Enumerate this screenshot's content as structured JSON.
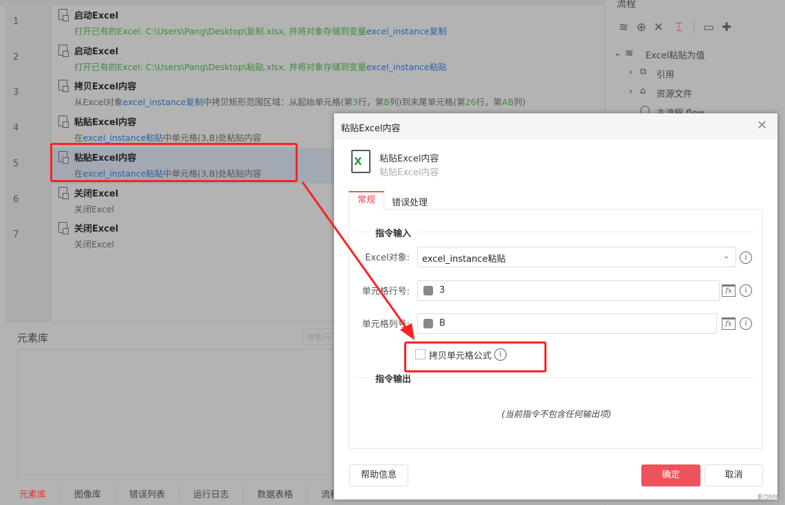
{
  "steps": [
    {
      "num": "1",
      "title": "启动Excel",
      "desc": [
        {
          "t": "打开已有的Excel: C:\\Users\\Pang\\Desktop\\复制.xlsx, 并将对象存储到变量",
          "c": "g"
        },
        {
          "t": "excel_instance复制",
          "c": "b"
        }
      ]
    },
    {
      "num": "2",
      "title": "启动Excel",
      "desc": [
        {
          "t": "打开已有的Excel: C:\\Users\\Pang\\Desktop\\粘贴.xlsx, 并将对象存储到变量",
          "c": "g"
        },
        {
          "t": "excel_instance粘贴",
          "c": "b"
        }
      ]
    },
    {
      "num": "3",
      "title": "拷贝Excel内容",
      "desc": [
        {
          "t": "从Excel对象",
          "c": ""
        },
        {
          "t": "excel_instance复制",
          "c": "b"
        },
        {
          "t": "中拷贝矩形范围区域：从起始单元格(第",
          "c": ""
        },
        {
          "t": "3",
          "c": "g"
        },
        {
          "t": "行，第",
          "c": ""
        },
        {
          "t": "B",
          "c": "g"
        },
        {
          "t": "列)到末尾单元格(第",
          "c": ""
        },
        {
          "t": "26",
          "c": "g"
        },
        {
          "t": "行，第",
          "c": ""
        },
        {
          "t": "AB",
          "c": "g"
        },
        {
          "t": "列)",
          "c": ""
        }
      ]
    },
    {
      "num": "4",
      "title": "粘贴Excel内容",
      "desc": [
        {
          "t": "在",
          "c": ""
        },
        {
          "t": "excel_instance粘贴",
          "c": "b"
        },
        {
          "t": "中单元格(3,B)处粘贴内容",
          "c": ""
        }
      ]
    },
    {
      "num": "5",
      "title": "粘贴Excel内容",
      "selected": true,
      "desc": [
        {
          "t": "在",
          "c": ""
        },
        {
          "t": "excel_instance粘贴",
          "c": "b"
        },
        {
          "t": "中单元格(3,B)处粘贴内容",
          "c": ""
        }
      ]
    },
    {
      "num": "6",
      "title": "关闭Excel",
      "desc": [
        {
          "t": "关闭Excel",
          "c": ""
        }
      ]
    },
    {
      "num": "7",
      "title": "关闭Excel",
      "desc": [
        {
          "t": "关闭Excel",
          "c": ""
        }
      ]
    }
  ],
  "bottom": {
    "title": "元素库",
    "search_placeholder": "搜索元",
    "tabs": [
      "元素库",
      "图像库",
      "错误列表",
      "运行日志",
      "数据表格",
      "流程参数"
    ],
    "active_tab": 0
  },
  "right": {
    "title": "流程",
    "tree": {
      "root": "Excel粘贴为值",
      "items": [
        "引用",
        "资源文件",
        "主流程.flow"
      ]
    }
  },
  "dialog": {
    "title": "粘贴Excel内容",
    "cmd_name": "粘贴Excel内容",
    "cmd_desc": "粘贴Excel内容",
    "tabs": [
      "常规",
      "错误处理"
    ],
    "active_tab": 0,
    "input_section": "指令输入",
    "output_section": "指令输出",
    "fields": {
      "excel_label": "Excel对象:",
      "excel_value": "excel_instance粘贴",
      "row_label": "单元格行号:",
      "row_value": "3",
      "col_label": "单元格列号:",
      "col_value": "B"
    },
    "checkbox": {
      "label": "拷贝单元格公式",
      "checked": false
    },
    "no_output": "(当前指令不包含任何输出项)",
    "help": "帮助信息",
    "ok": "确定",
    "cancel": "取消"
  },
  "watermark": "影刀RPA",
  "colors": {
    "accent": "#f0525c",
    "annotation": "#ff2020"
  }
}
